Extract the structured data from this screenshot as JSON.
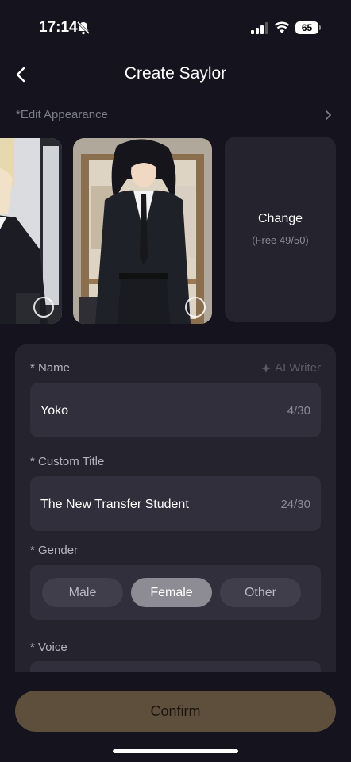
{
  "status_bar": {
    "time": "17:14",
    "battery": "65",
    "icons": [
      "bell-off-icon",
      "signal-icon",
      "wifi-icon",
      "battery-icon"
    ]
  },
  "header": {
    "title": "Create Saylor",
    "back_icon": "chevron-left-icon"
  },
  "appearance": {
    "label": "*Edit Appearance",
    "icon": "chevron-right-icon"
  },
  "carousel": {
    "change_label": "Change",
    "change_sub": "(Free 49/50)"
  },
  "form": {
    "name": {
      "label": "* Name",
      "value": "Yoko",
      "counter": "4/30",
      "ai_writer": "AI Writer"
    },
    "custom_title": {
      "label": "* Custom Title",
      "value": "The New Transfer Student",
      "counter": "24/30"
    },
    "gender": {
      "label": "* Gender",
      "options": [
        "Male",
        "Female",
        "Other"
      ],
      "selected": "Female"
    },
    "voice": {
      "label": "* Voice"
    }
  },
  "confirm_label": "Confirm",
  "colors": {
    "background": "#14131e",
    "panel": "#24232e",
    "field": "#302f3b",
    "confirm": "#5e4f3d",
    "selected_chip": "#8d8c94"
  }
}
